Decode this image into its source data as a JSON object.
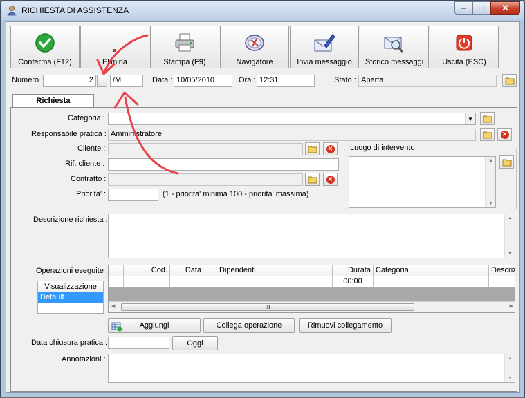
{
  "window": {
    "title": "RICHIESTA DI ASSISTENZA",
    "minimize": "–",
    "maximize": "□",
    "close": "✕"
  },
  "toolbar": {
    "buttons": [
      {
        "label": "Conferma (F12)",
        "icon": "confirm-check-icon"
      },
      {
        "label": "Elimina",
        "icon": "delete-icon"
      },
      {
        "label": "Stampa (F9)",
        "icon": "printer-icon"
      },
      {
        "label": "Navigatore",
        "icon": "compass-icon"
      },
      {
        "label": "Invia messaggio",
        "icon": "envelope-pen-icon"
      },
      {
        "label": "Storico messaggi",
        "icon": "envelope-search-icon"
      },
      {
        "label": "Uscita (ESC)",
        "icon": "exit-power-icon"
      }
    ]
  },
  "header": {
    "numero_label": "Numero :",
    "numero_value": "2",
    "numero_suffix": "/M",
    "data_label": "Data :",
    "data_value": "10/05/2010",
    "ora_label": "Ora :",
    "ora_value": "12:31",
    "stato_label": "Stato :",
    "stato_value": "Aperta"
  },
  "tab": {
    "label": "Richiesta"
  },
  "form": {
    "categoria_label": "Categoria :",
    "categoria_value": "",
    "responsabile_label": "Responsabile pratica :",
    "responsabile_value": "Amministratore",
    "cliente_label": "Cliente :",
    "cliente_value": "",
    "rif_cliente_label": "Rif. cliente :",
    "rif_cliente_value": "",
    "contratto_label": "Contratto :",
    "contratto_value": "",
    "priorita_label": "Priorita' :",
    "priorita_value": "",
    "priorita_hint": "(1 - priorita' minima  100 - priorita' massima)",
    "luogo_label": "Luogo di intervento",
    "descrizione_label": "Descrizione richiesta :",
    "operazioni_label": "Operazioni eseguite :",
    "chiusura_label": "Data chiusura pratica :",
    "chiusura_value": "",
    "oggi_label": "Oggi",
    "annotazioni_label": "Annotazioni :"
  },
  "visualizzazione": {
    "header": "Visualizzazione",
    "items": [
      "Default"
    ]
  },
  "grid": {
    "columns": [
      "Cod.",
      "Data",
      "Dipendenti",
      "Durata",
      "Categoria",
      "Descriz"
    ],
    "rows": [
      {
        "cod": "",
        "data": "",
        "dipendenti": "",
        "durata": "00:00",
        "categoria": "",
        "descrizione": ""
      }
    ],
    "hscroll_grip": "III"
  },
  "actions": {
    "aggiungi": "Aggiungi",
    "collega": "Collega operazione",
    "rimuovi": "Rimuovi collegamento"
  },
  "colors": {
    "annotation_arrow": "#e8424a",
    "selected_item": "#3399ff",
    "delete_red": "#d4311d"
  }
}
